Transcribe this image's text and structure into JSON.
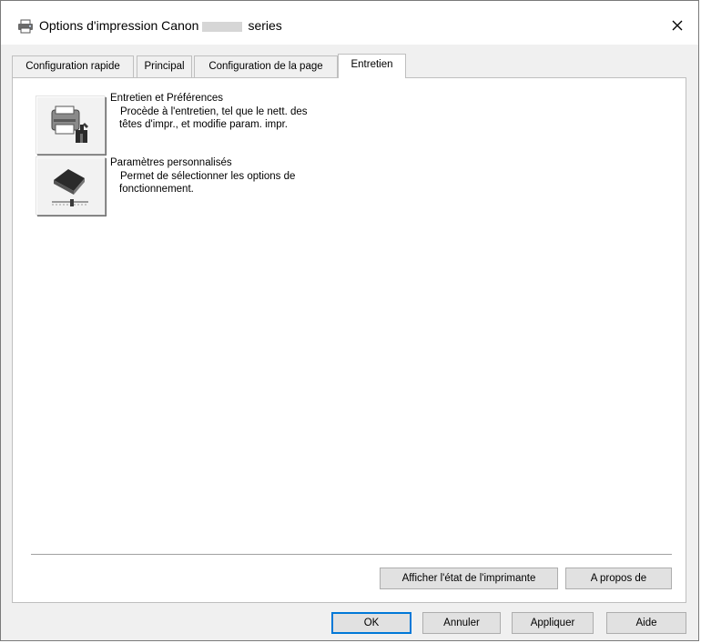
{
  "window": {
    "title_prefix": "Options d'impression Canon",
    "title_suffix": "series"
  },
  "tabs": [
    {
      "label": "Configuration rapide"
    },
    {
      "label": "Principal"
    },
    {
      "label": "Configuration de la page"
    },
    {
      "label": "Entretien"
    }
  ],
  "active_tab": "Entretien",
  "tools": [
    {
      "title": "Entretien et Préférences",
      "desc_line1": "Procède à l'entretien, tel que le nett. des",
      "desc_line2": "têtes d'impr., et modifie param. impr."
    },
    {
      "title": "Paramètres personnalisés",
      "desc_line1": "Permet de sélectionner les options de",
      "desc_line2": "fonctionnement."
    }
  ],
  "panel_buttons": {
    "printer_status": "Afficher l'état de l'imprimante",
    "about": "A propos de"
  },
  "dialog_buttons": {
    "ok": "OK",
    "cancel": "Annuler",
    "apply": "Appliquer",
    "help": "Aide"
  },
  "colors": {
    "default_button_border": "#0078d7",
    "panel_background": "#ffffff",
    "dialog_background": "#f0f0f0"
  }
}
